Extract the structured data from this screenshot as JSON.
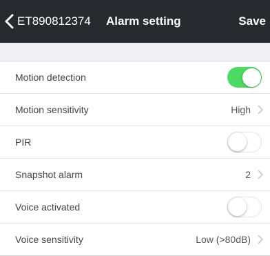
{
  "nav": {
    "device_id": "ET890812374",
    "title": "Alarm setting",
    "save_label": "Save",
    "back_icon": "chevron-left-icon",
    "background": "#262a2e"
  },
  "settings": [
    {
      "label": "Motion detection",
      "control": "toggle",
      "enabled": true
    },
    {
      "label": "Motion sensitivity",
      "control": "select",
      "value": "High"
    },
    {
      "label": "PIR",
      "control": "toggle",
      "enabled": false
    },
    {
      "label": "Snapshot alarm",
      "control": "select",
      "value": "2"
    },
    {
      "label": "Voice activated",
      "control": "toggle",
      "enabled": false
    },
    {
      "label": "Voice sensitivity",
      "control": "select",
      "value": "Low (>80dB)"
    }
  ],
  "colors": {
    "toggle_on": "#4cd964",
    "section_background": "#efeff4"
  }
}
